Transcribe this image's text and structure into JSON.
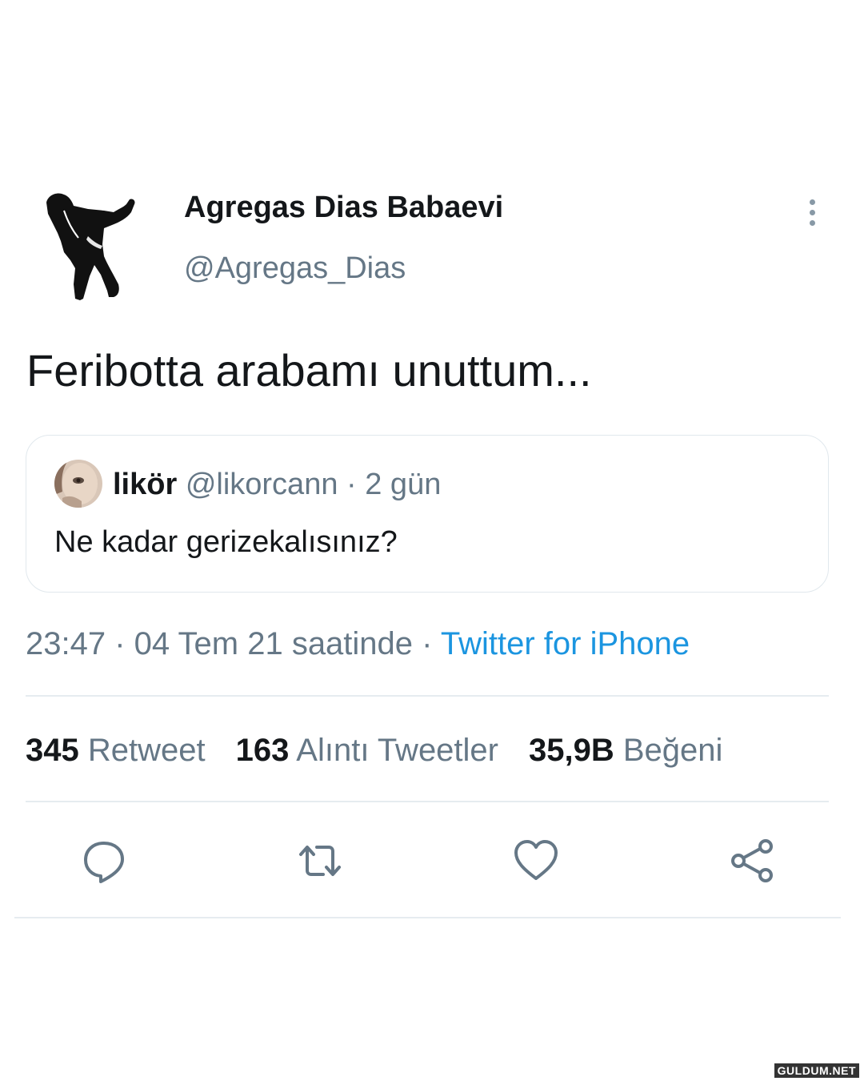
{
  "author": {
    "display_name": "Agregas Dias Babaevi",
    "handle": "@Agregas_Dias",
    "avatar_icon": "dancing-silhouette"
  },
  "tweet": {
    "text": "Feribotta arabamı unuttum..."
  },
  "quoted_tweet": {
    "name": "likör",
    "handle": "@likorcann",
    "time": "· 2 gün",
    "text": "Ne kadar gerizekalısınız?"
  },
  "meta": {
    "timestamp": "23:47 · 04 Tem 21 saatinde ·",
    "source": "Twitter for iPhone"
  },
  "stats": {
    "retweets_count": "345",
    "retweets_label": "Retweet",
    "quotes_count": "163",
    "quotes_label": "Alıntı Tweetler",
    "likes_count": "35,9B",
    "likes_label": "Beğeni"
  },
  "actions": [
    "reply-icon",
    "retweet-icon",
    "like-icon",
    "share-icon"
  ],
  "watermark": "GULDUM.NET",
  "colors": {
    "text_primary": "#14171a",
    "text_secondary": "#657786",
    "link": "#1b95e0",
    "border": "#e1e8ed",
    "icon": "#657786"
  }
}
